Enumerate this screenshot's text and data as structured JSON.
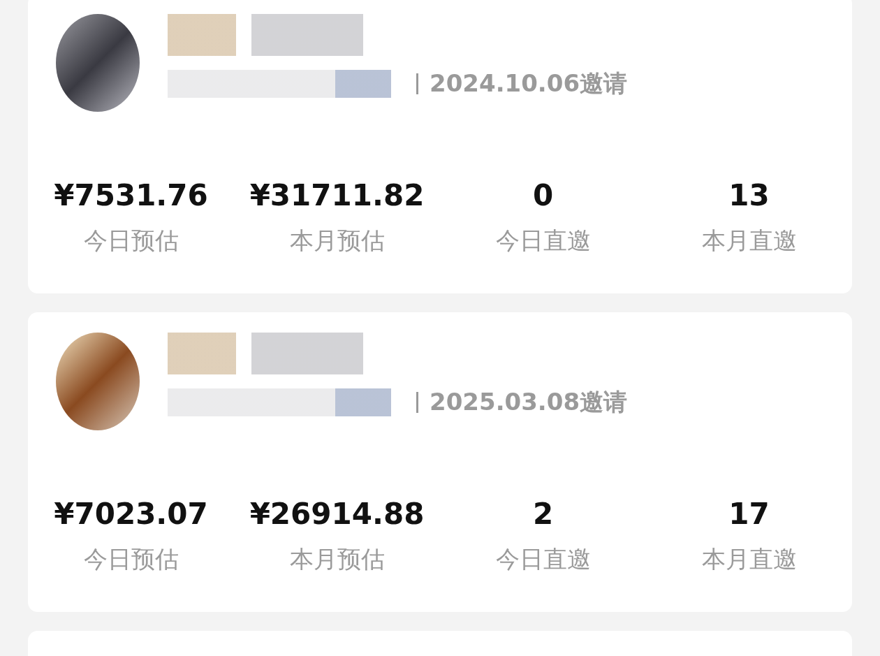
{
  "members": [
    {
      "invite_date": "2024.10.06邀请",
      "stats": [
        {
          "value": "¥7531.76",
          "label": "今日预估"
        },
        {
          "value": "¥31711.82",
          "label": "本月预估"
        },
        {
          "value": "0",
          "label": "今日直邀"
        },
        {
          "value": "13",
          "label": "本月直邀"
        }
      ]
    },
    {
      "invite_date": "2025.03.08邀请",
      "stats": [
        {
          "value": "¥7023.07",
          "label": "今日预估"
        },
        {
          "value": "¥26914.88",
          "label": "本月预估"
        },
        {
          "value": "2",
          "label": "今日直邀"
        },
        {
          "value": "17",
          "label": "本月直邀"
        }
      ]
    }
  ]
}
